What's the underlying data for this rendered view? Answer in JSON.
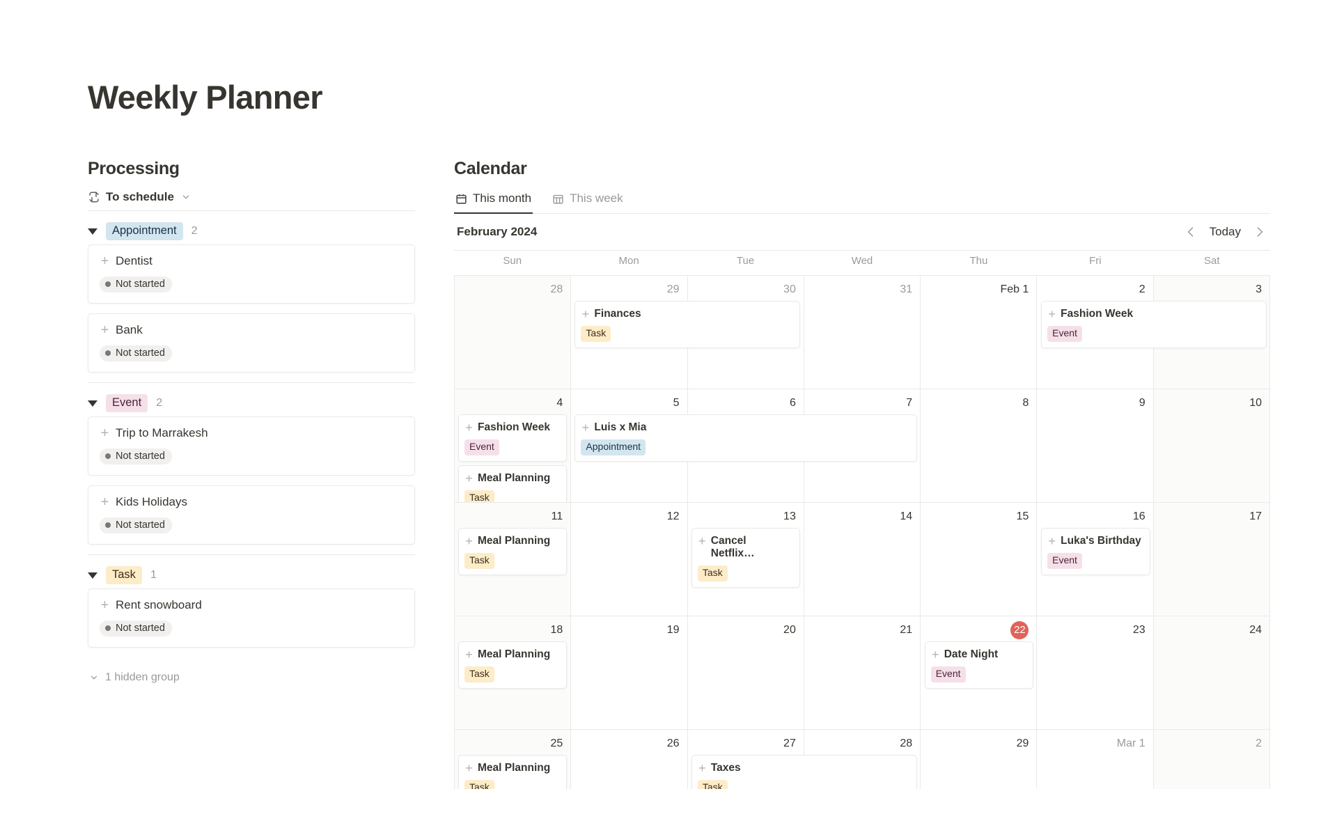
{
  "page": {
    "title": "Weekly Planner"
  },
  "sidebar": {
    "section_title": "Processing",
    "view": {
      "label": "To schedule",
      "icon": "sync-icon",
      "chevron": "chevron-down-icon"
    },
    "groups": [
      {
        "name": "Appointment",
        "type": "appointment",
        "count": "2",
        "cards": [
          {
            "title": "Dentist",
            "status": "Not started"
          },
          {
            "title": "Bank",
            "status": "Not started"
          }
        ]
      },
      {
        "name": "Event",
        "type": "event",
        "count": "2",
        "cards": [
          {
            "title": "Trip to Marrakesh",
            "status": "Not started"
          },
          {
            "title": "Kids Holidays",
            "status": "Not started"
          }
        ]
      },
      {
        "name": "Task",
        "type": "task",
        "count": "1",
        "cards": [
          {
            "title": "Rent snowboard",
            "status": "Not started"
          }
        ]
      }
    ],
    "hidden_group_label": "1 hidden group"
  },
  "calendar": {
    "section_title": "Calendar",
    "tabs": [
      {
        "label": "This month",
        "icon": "calendar-month-icon",
        "active": true
      },
      {
        "label": "This week",
        "icon": "calendar-week-icon",
        "active": false
      }
    ],
    "month_label": "February 2024",
    "today_label": "Today",
    "prev_icon": "chevron-left-icon",
    "next_icon": "chevron-right-icon",
    "day_names": [
      "Sun",
      "Mon",
      "Tue",
      "Wed",
      "Thu",
      "Fri",
      "Sat"
    ],
    "weeks": [
      {
        "days": [
          {
            "num": "28",
            "muted": true,
            "weekend": true
          },
          {
            "num": "29",
            "muted": true,
            "weekend": false
          },
          {
            "num": "30",
            "muted": true,
            "weekend": false
          },
          {
            "num": "31",
            "muted": true,
            "weekend": false
          },
          {
            "num": "Feb 1",
            "muted": false,
            "weekend": false
          },
          {
            "num": "2",
            "muted": false,
            "weekend": false
          },
          {
            "num": "3",
            "muted": false,
            "weekend": true
          }
        ],
        "events": [
          {
            "title": "Finances",
            "tag": "Task",
            "tag_type": "task",
            "start": 1,
            "span": 2,
            "row": 0
          },
          {
            "title": "Fashion Week",
            "tag": "Event",
            "tag_type": "event",
            "start": 5,
            "span": 2,
            "row": 0
          }
        ]
      },
      {
        "days": [
          {
            "num": "4",
            "muted": false,
            "weekend": true
          },
          {
            "num": "5",
            "muted": false,
            "weekend": false
          },
          {
            "num": "6",
            "muted": false,
            "weekend": false
          },
          {
            "num": "7",
            "muted": false,
            "weekend": false
          },
          {
            "num": "8",
            "muted": false,
            "weekend": false
          },
          {
            "num": "9",
            "muted": false,
            "weekend": false
          },
          {
            "num": "10",
            "muted": false,
            "weekend": true
          }
        ],
        "events": [
          {
            "title": "Fashion Week",
            "tag": "Event",
            "tag_type": "event",
            "start": 0,
            "span": 1,
            "row": 0
          },
          {
            "title": "Luis x Mia",
            "tag": "Appointment",
            "tag_type": "appointment",
            "start": 1,
            "span": 3,
            "row": 0
          },
          {
            "title": "Meal Planning",
            "tag": "Task",
            "tag_type": "task",
            "start": 0,
            "span": 1,
            "row": 1
          }
        ]
      },
      {
        "days": [
          {
            "num": "11",
            "muted": false,
            "weekend": true
          },
          {
            "num": "12",
            "muted": false,
            "weekend": false
          },
          {
            "num": "13",
            "muted": false,
            "weekend": false
          },
          {
            "num": "14",
            "muted": false,
            "weekend": false
          },
          {
            "num": "15",
            "muted": false,
            "weekend": false
          },
          {
            "num": "16",
            "muted": false,
            "weekend": false
          },
          {
            "num": "17",
            "muted": false,
            "weekend": true
          }
        ],
        "events": [
          {
            "title": "Meal Planning",
            "tag": "Task",
            "tag_type": "task",
            "start": 0,
            "span": 1,
            "row": 0
          },
          {
            "title": "Cancel Netflix…",
            "tag": "Task",
            "tag_type": "task",
            "start": 2,
            "span": 1,
            "row": 0
          },
          {
            "title": "Luka's Birthday",
            "tag": "Event",
            "tag_type": "event",
            "start": 5,
            "span": 1,
            "row": 0
          }
        ]
      },
      {
        "days": [
          {
            "num": "18",
            "muted": false,
            "weekend": true
          },
          {
            "num": "19",
            "muted": false,
            "weekend": false
          },
          {
            "num": "20",
            "muted": false,
            "weekend": false
          },
          {
            "num": "21",
            "muted": false,
            "weekend": false
          },
          {
            "num": "22",
            "muted": false,
            "weekend": false,
            "today": true
          },
          {
            "num": "23",
            "muted": false,
            "weekend": false
          },
          {
            "num": "24",
            "muted": false,
            "weekend": true
          }
        ],
        "events": [
          {
            "title": "Meal Planning",
            "tag": "Task",
            "tag_type": "task",
            "start": 0,
            "span": 1,
            "row": 0
          },
          {
            "title": "Date Night",
            "tag": "Event",
            "tag_type": "event",
            "start": 4,
            "span": 1,
            "row": 0
          }
        ]
      },
      {
        "days": [
          {
            "num": "25",
            "muted": false,
            "weekend": true
          },
          {
            "num": "26",
            "muted": false,
            "weekend": false
          },
          {
            "num": "27",
            "muted": false,
            "weekend": false
          },
          {
            "num": "28",
            "muted": false,
            "weekend": false
          },
          {
            "num": "29",
            "muted": false,
            "weekend": false
          },
          {
            "num": "Mar 1",
            "muted": true,
            "weekend": false
          },
          {
            "num": "2",
            "muted": true,
            "weekend": true
          }
        ],
        "events": [
          {
            "title": "Meal Planning",
            "tag": "Task",
            "tag_type": "task",
            "start": 0,
            "span": 1,
            "row": 0
          },
          {
            "title": "Taxes",
            "tag": "Task",
            "tag_type": "task",
            "start": 2,
            "span": 2,
            "row": 0
          }
        ]
      }
    ]
  },
  "colors": {
    "today_badge": "#e16259",
    "appointment": "#d3e5ef",
    "event": "#f5e0e9",
    "task": "#fdecc8",
    "border": "#e9e9e7",
    "text": "#37352f",
    "muted": "#9b9a97"
  }
}
